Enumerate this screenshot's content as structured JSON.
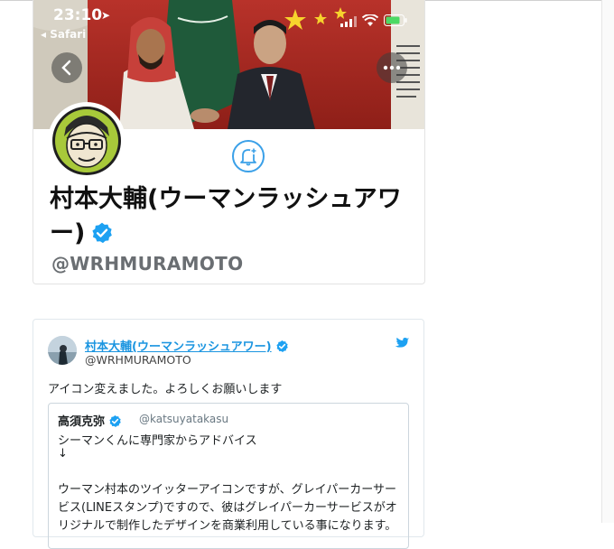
{
  "status": {
    "time": "23:10",
    "back_app": "◂ Safari"
  },
  "profile": {
    "name": "村本大輔(ウーマンラッシュアワー)",
    "handle": "@WRHMURAMOTO"
  },
  "tweet": {
    "name": "村本大輔(ウーマンラッシュアワー)",
    "handle": "@WRHMURAMOTO",
    "text": "アイコン変えました。よろしくお願いします",
    "quote": {
      "name": "高須克弥",
      "handle": "@katsuyatakasu",
      "lines": [
        "シーマンくんに専門家からアドバイス",
        "↓",
        "",
        "ウーマン村本のツイッターアイコンですが、グレイパーカーサー",
        "ビス(LINEスタンプ)ですので、彼はグレイパーカーサービスがオ",
        "リジナルで制作したデザインを商業利用している事になります。"
      ]
    }
  },
  "colors": {
    "link": "#1b95e0",
    "verified": "#1da1f2",
    "handle_gray": "#6a6e72"
  },
  "icons": [
    "chevron-left-icon",
    "more-icon",
    "bell-plus-icon",
    "verified-badge-icon",
    "twitter-bird-icon"
  ]
}
